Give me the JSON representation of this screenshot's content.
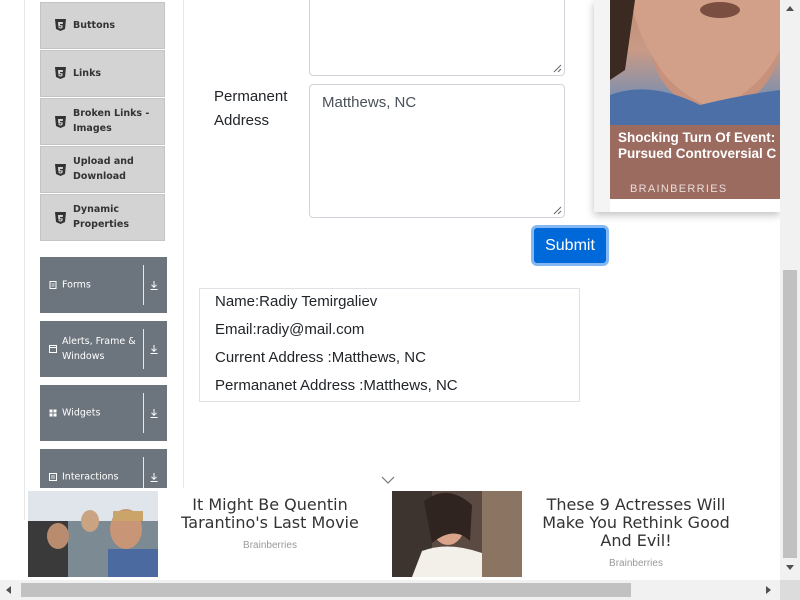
{
  "sidebar": {
    "elements_items": [
      {
        "label": "Buttons",
        "icon": "html5-icon"
      },
      {
        "label": "Links",
        "icon": "html5-icon"
      },
      {
        "label": "Broken Links - Images",
        "icon": "html5-icon"
      },
      {
        "label": "Upload and Download",
        "icon": "html5-icon"
      },
      {
        "label": "Dynamic Properties",
        "icon": "html5-icon"
      }
    ],
    "groups": [
      {
        "label": "Forms",
        "icon": "form-icon"
      },
      {
        "label": "Alerts, Frame & Windows",
        "icon": "window-icon"
      },
      {
        "label": "Widgets",
        "icon": "grid-icon"
      },
      {
        "label": "Interactions",
        "icon": "list-icon"
      }
    ]
  },
  "form": {
    "permanent_address_label": "Permanent Address",
    "permanent_address_value": "Matthews, NC",
    "submit_label": "Submit"
  },
  "output": {
    "name": "Name:Radiy Temirgaliev",
    "email": "Email:radiy@mail.com",
    "current_address": "Current Address :Matthews, NC",
    "permanent_address": "Permananet Address :Matthews, NC"
  },
  "ad_top": {
    "headline_line1": "Shocking Turn Of Event:",
    "headline_line2": "Pursued Controversial C",
    "brand": "BRAINBERRIES"
  },
  "ad_bottom": {
    "cards": [
      {
        "title": "It Might Be Quentin Tarantino's Last Movie",
        "source": "Brainberries"
      },
      {
        "title": "These 9 Actresses Will Make You Rethink Good And Evil!",
        "source": "Brainberries"
      }
    ]
  },
  "colors": {
    "sidebar_item_bg": "#d3d3d3",
    "sidebar_group_bg": "#6c757d",
    "submit_bg": "#0069d9"
  }
}
